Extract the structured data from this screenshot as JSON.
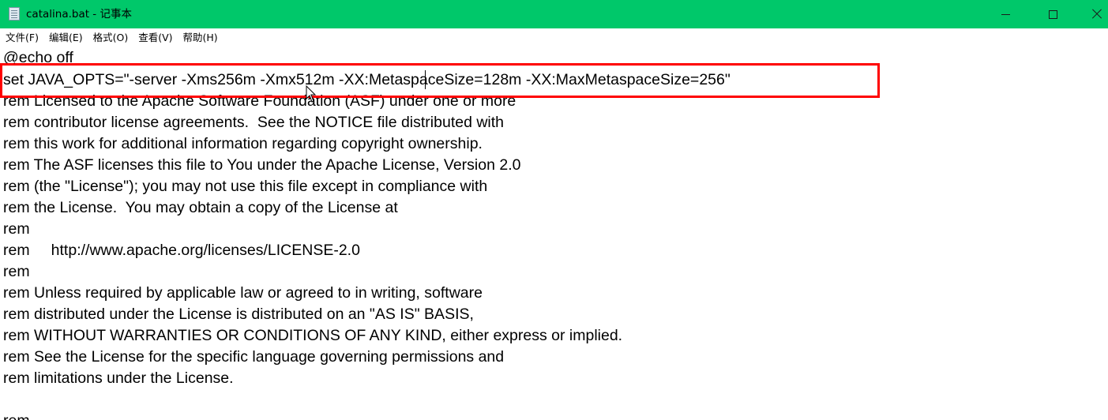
{
  "window": {
    "title": "catalina.bat - 记事本",
    "app_icon": "notepad-icon",
    "controls": [
      "minimize-icon",
      "maximize-icon",
      "close-icon"
    ],
    "titlebar_color": "#00c86a"
  },
  "menu": {
    "items": [
      "文件(F)",
      "编辑(E)",
      "格式(O)",
      "查看(V)",
      "帮助(H)"
    ]
  },
  "editor": {
    "lines": [
      "@echo off",
      "set JAVA_OPTS=\"-server -Xms256m -Xmx512m -XX:MetaspaceSize=128m -XX:MaxMetaspaceSize=256\"",
      "rem Licensed to the Apache Software Foundation (ASF) under one or more",
      "rem contributor license agreements.  See the NOTICE file distributed with",
      "rem this work for additional information regarding copyright ownership.",
      "rem The ASF licenses this file to You under the Apache License, Version 2.0",
      "rem (the \"License\"); you may not use this file except in compliance with",
      "rem the License.  You may obtain a copy of the License at",
      "rem",
      "rem     http://www.apache.org/licenses/LICENSE-2.0",
      "rem",
      "rem Unless required by applicable law or agreed to in writing, software",
      "rem distributed under the License is distributed on an \"AS IS\" BASIS,",
      "rem WITHOUT WARRANTIES OR CONDITIONS OF ANY KIND, either express or implied.",
      "rem See the License for the specific language governing permissions and",
      "rem limitations under the License.",
      "",
      "rem"
    ],
    "highlight_color": "#ff0000",
    "highlighted_line": 1
  }
}
